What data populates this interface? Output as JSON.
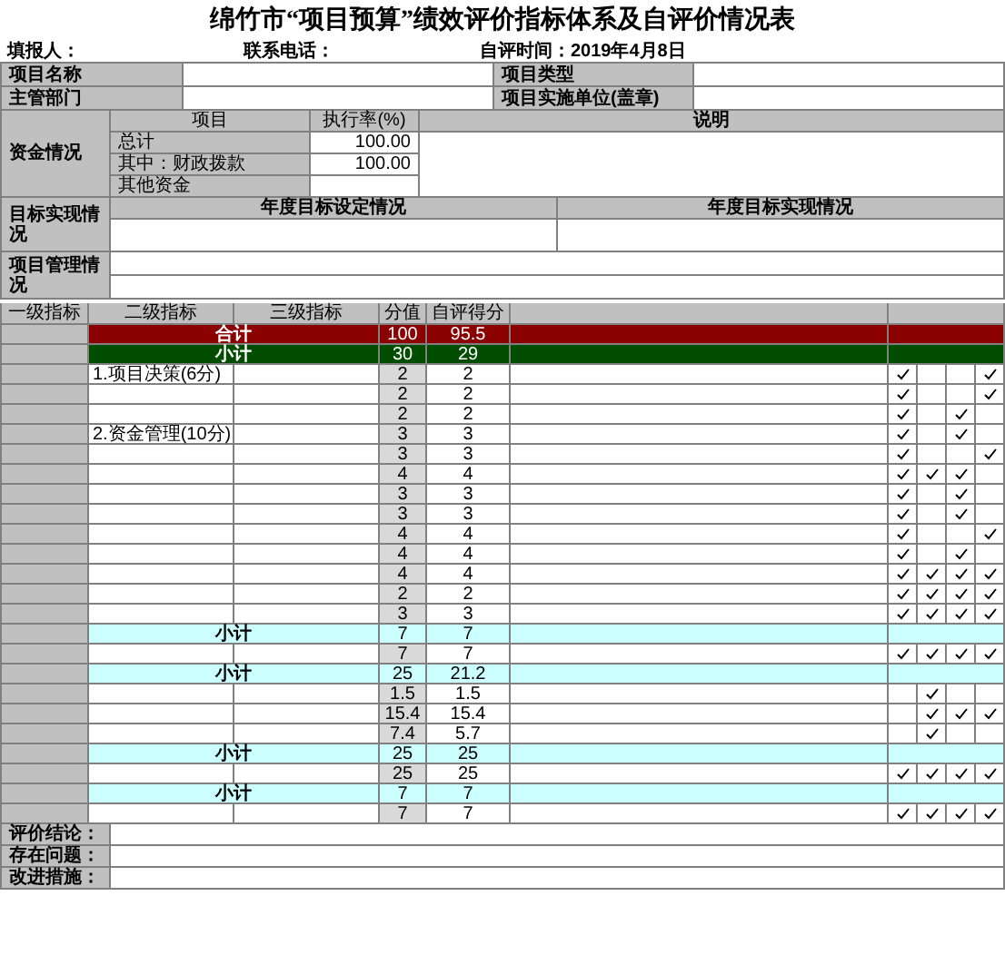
{
  "title": "绵竹市“项目预算”绩效评价指标体系及自评价情况表",
  "info": [
    {
      "label": "填报人："
    },
    {
      "label": "联系电话："
    },
    {
      "label": "自评时间：2019年4月8日"
    }
  ],
  "project_fields": [
    {
      "label": "项目名称"
    },
    {
      "label": "项目类型"
    },
    {
      "label": "主管部门"
    },
    {
      "label": "项目实施单位(盖章)"
    }
  ],
  "funds": {
    "label": "资金情况",
    "headers": [
      "项目",
      "执行率(%)",
      "说明"
    ],
    "rows": [
      {
        "name": "总计",
        "rate": "100.00"
      },
      {
        "name": "其中：财政拨款",
        "rate": "100.00"
      },
      {
        "name": "其他资金"
      }
    ]
  },
  "goals": {
    "label": "目标实现情况",
    "headers": [
      "年度目标设定情况",
      "年度目标实现情况"
    ]
  },
  "management": {
    "label": "项目管理情况"
  },
  "indicators": {
    "headers": [
      "一级指标",
      "二级指标",
      "三级指标",
      "分值",
      "自评得分"
    ],
    "rows": [
      {
        "kind": "total",
        "label": "合计",
        "score": "100",
        "self": "95.5"
      },
      {
        "kind": "section",
        "label": "小计",
        "score": "30",
        "self": "29"
      },
      {
        "kind": "item",
        "group": "1.项目决策(6分)",
        "score": "2",
        "self": "2",
        "checks": [
          true,
          false,
          false,
          true
        ]
      },
      {
        "kind": "item",
        "score": "2",
        "self": "2",
        "checks": [
          true,
          false,
          false,
          true
        ]
      },
      {
        "kind": "item",
        "score": "2",
        "self": "2",
        "checks": [
          true,
          false,
          true,
          false
        ]
      },
      {
        "kind": "item",
        "group": "2.资金管理(10分)",
        "score": "3",
        "self": "3",
        "checks": [
          true,
          false,
          true,
          false
        ]
      },
      {
        "kind": "item",
        "score": "3",
        "self": "3",
        "checks": [
          true,
          false,
          false,
          true
        ]
      },
      {
        "kind": "item",
        "score": "4",
        "self": "4",
        "checks": [
          true,
          true,
          true,
          false
        ]
      },
      {
        "kind": "item",
        "score": "3",
        "self": "3",
        "checks": [
          true,
          false,
          true,
          false
        ]
      },
      {
        "kind": "item",
        "score": "3",
        "self": "3",
        "checks": [
          true,
          false,
          true,
          false
        ]
      },
      {
        "kind": "item",
        "score": "4",
        "self": "4",
        "checks": [
          true,
          false,
          false,
          true
        ]
      },
      {
        "kind": "item",
        "score": "4",
        "self": "4",
        "checks": [
          true,
          false,
          true,
          false
        ]
      },
      {
        "kind": "item",
        "score": "4",
        "self": "4",
        "checks": [
          true,
          true,
          true,
          true
        ]
      },
      {
        "kind": "item",
        "score": "2",
        "self": "2",
        "checks": [
          true,
          true,
          true,
          true
        ]
      },
      {
        "kind": "item",
        "score": "3",
        "self": "3",
        "checks": [
          true,
          true,
          true,
          true
        ]
      },
      {
        "kind": "subtotal",
        "label": "小计",
        "score": "7",
        "self": "7"
      },
      {
        "kind": "item",
        "score": "7",
        "self": "7",
        "checks": [
          true,
          true,
          true,
          true
        ]
      },
      {
        "kind": "subtotal",
        "label": "小计",
        "score": "25",
        "self": "21.2"
      },
      {
        "kind": "item",
        "score": "1.5",
        "self": "1.5",
        "checks": [
          false,
          true,
          false,
          false
        ]
      },
      {
        "kind": "item",
        "score": "15.4",
        "self": "15.4",
        "checks": [
          false,
          true,
          true,
          true
        ]
      },
      {
        "kind": "item",
        "score": "7.4",
        "self": "5.7",
        "checks": [
          false,
          true,
          false,
          false
        ]
      },
      {
        "kind": "subtotal",
        "label": "小计",
        "score": "25",
        "self": "25"
      },
      {
        "kind": "item",
        "score": "25",
        "self": "25",
        "checks": [
          true,
          true,
          true,
          true
        ]
      },
      {
        "kind": "subtotal",
        "label": "小计",
        "score": "7",
        "self": "7"
      },
      {
        "kind": "item",
        "score": "7",
        "self": "7",
        "checks": [
          true,
          true,
          true,
          true
        ]
      }
    ]
  },
  "conclusions": [
    {
      "label": "评价结论："
    },
    {
      "label": "存在问题："
    },
    {
      "label": "改进措施："
    }
  ]
}
